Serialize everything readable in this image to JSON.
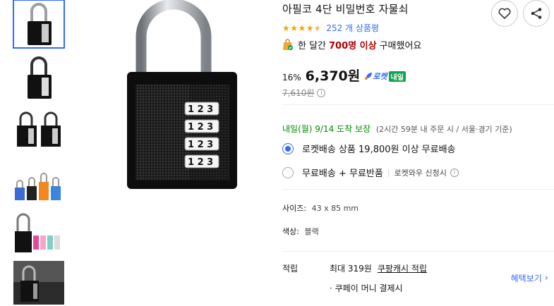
{
  "product": {
    "title": "아필코 4단 비밀번호 자물쇠",
    "rating": 4.5,
    "review_count": "252 개 상품평",
    "sold_prefix": "한 달간",
    "sold_count": "700명 이상",
    "sold_suffix": "구매했어요"
  },
  "price": {
    "discount": "16%",
    "sale_price": "6,370원",
    "rocket_label": "로켓",
    "rocket_tag": "내일",
    "original_price": "7,610원",
    "info_glyph": "i"
  },
  "delivery": {
    "arrival": "내일(월) 9/14",
    "guarantee": "도착 보장",
    "note": "(2시간 59분 내 주문 시 / 서울·경기 기준)"
  },
  "shipping_options": [
    {
      "label": "로켓배송 상품 19,800원 이상 무료배송",
      "selected": true
    },
    {
      "label": "무료배송 + 무료반품",
      "separator": "|",
      "sub": "로켓와우 신청시",
      "selected": false
    }
  ],
  "specs": {
    "size_label": "사이즈:",
    "size_value": "43 x 85 mm",
    "color_label": "색상:",
    "color_value": "블랙"
  },
  "benefits": {
    "label": "적립",
    "line1_prefix": "최대 319원",
    "line1_link": "쿠팡캐시 적립",
    "line2": "· 쿠페이 머니 결제시",
    "more": "혜택보기",
    "more_chevron": "›"
  },
  "icons": {
    "wishlist": "heart-icon",
    "share": "share-icon",
    "bag": "bag-check-icon",
    "rocket": "rocket-icon"
  },
  "colors": {
    "accent": "#346aff",
    "sold_highlight": "#ae0000",
    "delivery_green": "#008c00",
    "star": "#f5a300",
    "tag_green": "#11a44c"
  }
}
